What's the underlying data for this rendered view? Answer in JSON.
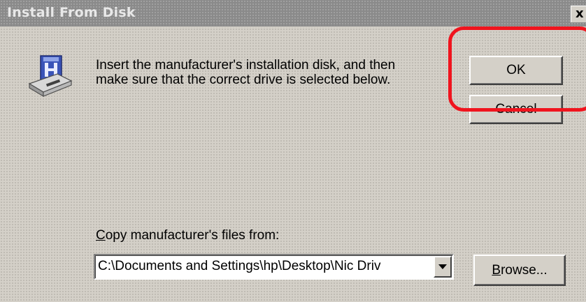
{
  "window": {
    "title": "Install From Disk",
    "close_label": "x"
  },
  "icon": {
    "name": "floppy-drive-icon"
  },
  "message": {
    "line1": "Insert the manufacturer's installation disk, and then",
    "line2": "make sure that the correct drive is selected below."
  },
  "buttons": {
    "ok_label": "OK",
    "cancel_label": "Cancel",
    "browse_label_accel": "B",
    "browse_label_rest": "rowse..."
  },
  "copy_from": {
    "label_accel": "C",
    "label_rest": "opy manufacturer's files from:",
    "value": "C:\\Documents and Settings\\hp\\Desktop\\Nic Driv"
  },
  "colors": {
    "highlight": "#f0141e",
    "face": "#d4d0c8"
  }
}
